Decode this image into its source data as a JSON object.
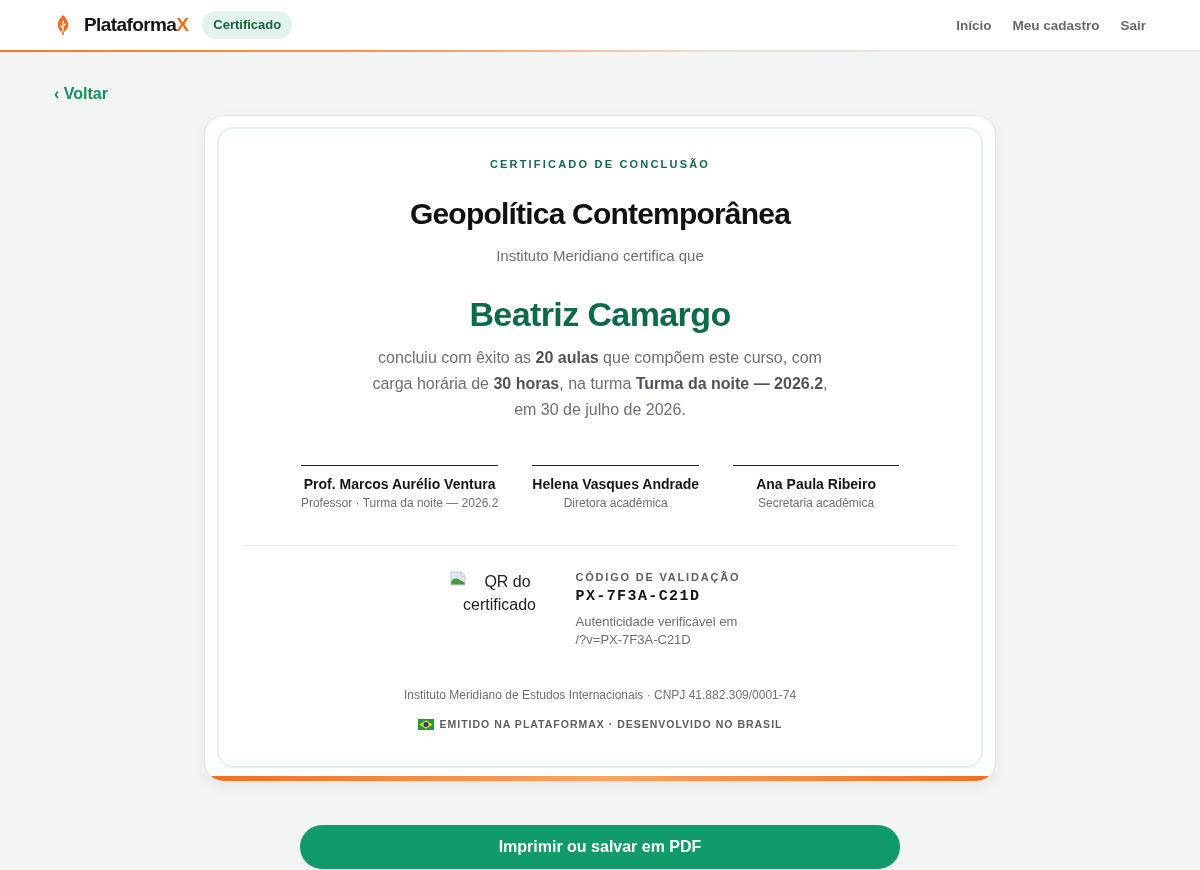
{
  "header": {
    "brand": {
      "name": "Plataforma",
      "accent": "X"
    },
    "badge": "Certificado",
    "nav": [
      {
        "label": "Início"
      },
      {
        "label": "Meu cadastro"
      },
      {
        "label": "Sair"
      }
    ]
  },
  "back_link": "‹ Voltar",
  "certificate": {
    "eyebrow": "CERTIFICADO DE CONCLUSÃO",
    "course": "Geopolítica Contemporânea",
    "issuer_line": "Instituto Meridiano certifica que",
    "student": "Beatriz Camargo",
    "body": "concluiu com êxito as **20 aulas** que compõem este curso, com carga horária de **30 horas**, na turma **Turma da noite — 2026.2**, em 30 de julho de 2026.",
    "signatures": [
      {
        "name": "Prof. Marcos Aurélio Ventura",
        "role": "Professor · Turma da noite — 2026.2"
      },
      {
        "name": "Helena Vasques Andrade",
        "role": "Diretora acadêmica"
      },
      {
        "name": "Ana Paula Ribeiro",
        "role": "Secretaria acadêmica"
      }
    ],
    "qr": {
      "alt": "QR do certificado"
    },
    "validation": {
      "label": "CÓDIGO DE VALIDAÇÃO",
      "code": "PX-7F3A-C21D",
      "note": "Autenticidade verificável em /?v=PX-7F3A-C21D"
    },
    "footer": "Instituto Meridiano de Estudos Internacionais · CNPJ 41.882.309/0001-74",
    "platform_line": "EMITIDO NA PLATAFORMAX · DESENVOLVIDO NO BRASIL"
  },
  "print_button": "Imprimir ou salvar em PDF"
}
